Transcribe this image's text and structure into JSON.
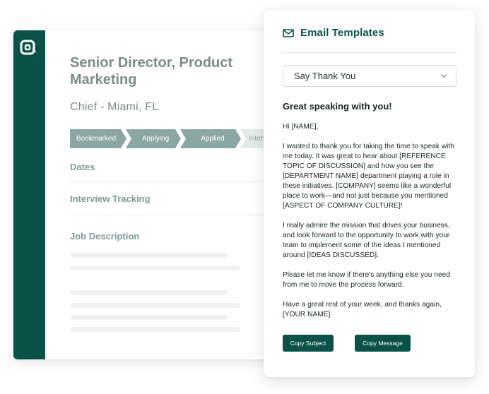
{
  "job": {
    "title": "Senior Director, Product Marketing",
    "company_location": "Chief - Miami, FL",
    "pipeline": [
      "Bookmarked",
      "Applying",
      "Applied",
      "Intervi"
    ],
    "sections": {
      "dates": "Dates",
      "interview_tracking": "Interview Tracking",
      "job_description": "Job Description"
    }
  },
  "email_panel": {
    "title": "Email Templates",
    "selected_template": "Say Thank You",
    "subject": "Great speaking with you!",
    "body": [
      "Hi [NAME],",
      "I wanted to thank you for taking the time to speak with me today. It was great to hear about [REFERENCE TOPIC OF DISCUSSION] and how you see the [DEPARTMENT NAME] department playing a role in these initiatives. [COMPANY] seems like a wonderful place to work—and not just because you mentioned [ASPECT OF COMPANY CULTURE]!",
      "I really admire the mission that drives your business, and look forward to the opportunity to work with your team to implement some of the ideas I mentioned around [IDEAS DISCUSSED].",
      "Please let me know if there's anything else you need from me to move the process forward.",
      "Have a great rest of your week, and thanks again, [YOUR NAME]"
    ],
    "buttons": {
      "copy_subject": "Copy Subject",
      "copy_message": "Copy Message"
    }
  },
  "colors": {
    "brand": "#0a5248",
    "pipeline_active": "#8aa7a3",
    "muted_text": "#7e8a89"
  },
  "icons": [
    "logo-icon",
    "mail-icon",
    "chevron-down-icon"
  ]
}
